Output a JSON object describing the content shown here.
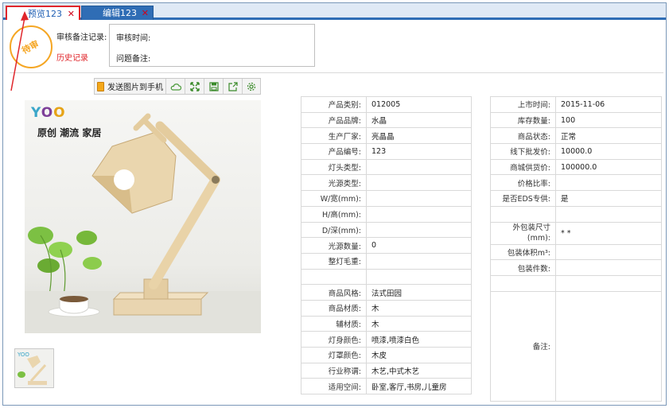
{
  "tabs": [
    {
      "label": "预览123",
      "active": true
    },
    {
      "label": "编辑123",
      "active": false
    }
  ],
  "audit": {
    "stamp_text": "待审",
    "review_label": "审核备注记录:",
    "history_label": "历史记录",
    "time_label": "审核时间:",
    "remark_label": "问题备注:"
  },
  "toolbar": {
    "send_label": "发送图片到手机",
    "icons": [
      "photo-icon",
      "cloud-icon",
      "fullscreen-icon",
      "save-icon",
      "export-icon",
      "settings-icon"
    ]
  },
  "image": {
    "brand": "YOO",
    "slogan": "原创 潮流 家居"
  },
  "spec_left": [
    {
      "k": "产品类别:",
      "v": "012005"
    },
    {
      "k": "产品品牌:",
      "v": "水晶"
    },
    {
      "k": "生产厂家:",
      "v": "亮晶晶"
    },
    {
      "k": "产品编号:",
      "v": "123"
    },
    {
      "k": "灯头类型:",
      "v": ""
    },
    {
      "k": "光源类型:",
      "v": ""
    },
    {
      "k": "W/宽(mm):",
      "v": ""
    },
    {
      "k": "H/高(mm):",
      "v": ""
    },
    {
      "k": "D/深(mm):",
      "v": ""
    },
    {
      "k": "光源数量:",
      "v": "0"
    },
    {
      "k": "整灯毛重:",
      "v": ""
    },
    {
      "k": "",
      "v": ""
    },
    {
      "k": "商品风格:",
      "v": "法式田园"
    },
    {
      "k": "商品材质:",
      "v": "木"
    },
    {
      "k": "辅材质:",
      "v": "木"
    },
    {
      "k": "灯身颜色:",
      "v": "喷漆,喷漆白色"
    },
    {
      "k": "灯罩颜色:",
      "v": "木皮"
    },
    {
      "k": "行业称谓:",
      "v": "木艺,中式木艺"
    },
    {
      "k": "适用空间:",
      "v": "卧室,客厅,书房,儿童房"
    }
  ],
  "spec_right": [
    {
      "k": "上市时间:",
      "v": "2015-11-06"
    },
    {
      "k": "库存数量:",
      "v": "100"
    },
    {
      "k": "商品状态:",
      "v": "正常"
    },
    {
      "k": "线下批发价:",
      "v": "10000.0"
    },
    {
      "k": "商城供货价:",
      "v": "100000.0"
    },
    {
      "k": "价格比率:",
      "v": ""
    },
    {
      "k": "是否EDS专供:",
      "v": "是"
    },
    {
      "k": "",
      "v": ""
    },
    {
      "k": "外包装尺寸(mm):",
      "v": "* *"
    },
    {
      "k": "包装体积m³:",
      "v": ""
    },
    {
      "k": "包装件数:",
      "v": ""
    },
    {
      "k": "",
      "v": ""
    },
    {
      "k": "备注:",
      "v": ""
    }
  ]
}
